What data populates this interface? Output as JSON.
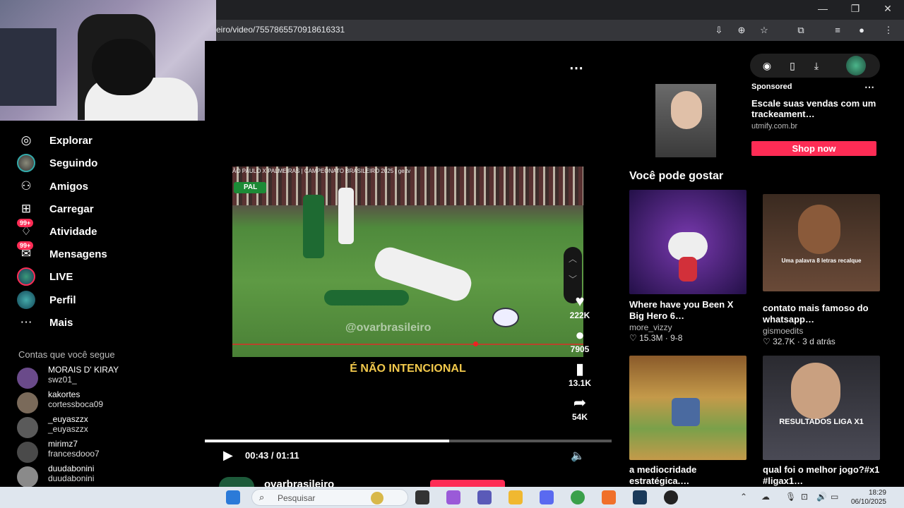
{
  "browser": {
    "url": "eiro/video/7557865570918616331",
    "window_controls": {
      "minimize": "—",
      "restore": "❐",
      "close": "✕"
    }
  },
  "sidebar": {
    "items": [
      {
        "label": "Explorar",
        "icon": "compass-icon"
      },
      {
        "label": "Seguindo",
        "icon": "following-avatar"
      },
      {
        "label": "Amigos",
        "icon": "friends-icon"
      },
      {
        "label": "Carregar",
        "icon": "upload-icon"
      },
      {
        "label": "Atividade",
        "icon": "activity-icon",
        "badge": "99+"
      },
      {
        "label": "Mensagens",
        "icon": "messages-icon",
        "badge": "99+"
      },
      {
        "label": "LIVE",
        "icon": "live-avatar"
      },
      {
        "label": "Perfil",
        "icon": "profile-avatar"
      },
      {
        "label": "Mais",
        "icon": "more-icon"
      }
    ],
    "following_title": "Contas que você segue",
    "following": [
      {
        "name": "MORAIS D' KIRAY",
        "user": "swz01_"
      },
      {
        "name": "kakortes",
        "user": "cortessboca09"
      },
      {
        "name": "_euyaszzx",
        "user": "_euyaszzx"
      },
      {
        "name": "mirimz7",
        "user": "francesdooo7"
      },
      {
        "name": "duudabonini",
        "user": "duudabonini"
      }
    ]
  },
  "video": {
    "ticker": "ÃO PAULO X PALMEIRAS | CAMPEONATO BRASILEIRO 2025 | ge.tv",
    "team_badge": "PAL",
    "watermark": "@ovarbrasileiro",
    "caption": "É NÃO INTENCIONAL",
    "likes": "222K",
    "comments": "7905",
    "saves": "13.1K",
    "shares": "54K",
    "time": "00:43 / 01:11",
    "progress": 0.6,
    "author": "ovarbrasileiro"
  },
  "sponsored": {
    "label": "Sponsored",
    "title": "Escale suas vendas com um trackeament…",
    "url": "utmify.com.br",
    "button": "Shop now"
  },
  "recommend": {
    "title": "Você pode gostar",
    "cards": [
      {
        "title": "Where have you Been X Big Hero 6…",
        "author": "more_vizzy",
        "meta": "♡ 15.3M · 9-8"
      },
      {
        "title": "contato mais famoso do whatsapp…",
        "author": "gismoedits",
        "meta": "♡ 32.7K · 3 d atrás",
        "thumb_text": "Uma palavra 8 letras recalque"
      },
      {
        "title": "a mediocridade estratégica.…",
        "author": "",
        "meta": ""
      },
      {
        "title": "qual foi o melhor jogo?#x1 #ligax1…",
        "author": "",
        "meta": "",
        "thumb_text": "RESULTADOS LIGA X1"
      }
    ]
  },
  "taskbar": {
    "search_placeholder": "Pesquisar",
    "time": "18:29",
    "date": "06/10/2025"
  }
}
